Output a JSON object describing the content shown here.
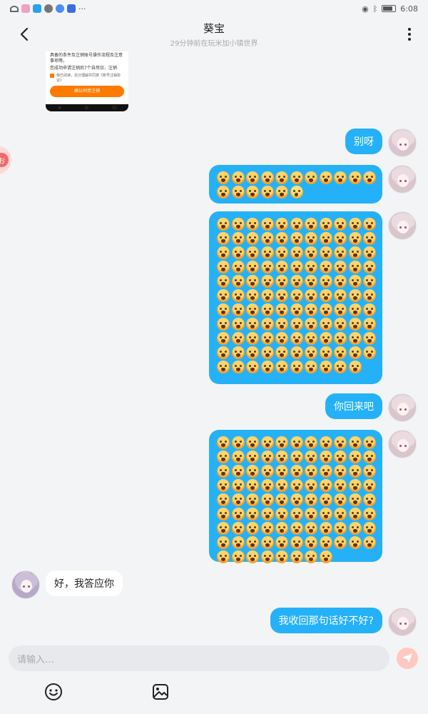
{
  "status_bar": {
    "time": "6:08"
  },
  "header": {
    "title": "葵宝",
    "subtitle": "29分钟前在玩米加小镇世界"
  },
  "screenshot_preview": {
    "text1": "手账号注销后在无法找回，注销账号应具备的条件及注销账号操作流程及注意事项等。",
    "text2": "您成功申请注销后7个自然日，注销",
    "checkbox_text": "我已阅读，充分理解并同意《账号注销协议》",
    "button": "确认同意注销",
    "nav_back": "◁",
    "nav_home": "○",
    "nav_recent": "□"
  },
  "floating_badge": "お",
  "messages": [
    {
      "id": "m1",
      "side": "out",
      "type": "text",
      "text": "别呀"
    },
    {
      "id": "m2",
      "side": "out",
      "type": "emoji",
      "emoji_name": "loudly-crying-face",
      "count": 16,
      "last_variant": "anguished-face"
    },
    {
      "id": "m3",
      "side": "out",
      "type": "emoji",
      "emoji_name": "loudly-crying-face",
      "count": 120
    },
    {
      "id": "m4",
      "side": "out",
      "type": "text",
      "text": "你回来吧"
    },
    {
      "id": "m5",
      "side": "out",
      "type": "emoji",
      "emoji_name": "loudly-crying-face",
      "count": 96
    },
    {
      "id": "m6",
      "side": "in",
      "type": "text",
      "text": "好，我答应你"
    },
    {
      "id": "m7",
      "side": "out",
      "type": "text",
      "text": "我收回那句话好不好?"
    }
  ],
  "input": {
    "placeholder": "请输入…"
  },
  "colors": {
    "accent": "#25b1f7",
    "send": "#ffc8c0",
    "background": "#f3f4f6"
  }
}
